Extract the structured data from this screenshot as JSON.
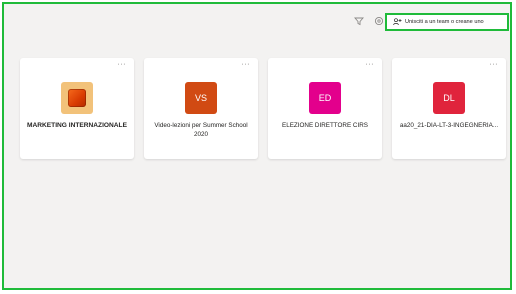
{
  "toolbar": {
    "filter_icon": "filter-icon",
    "settings_icon": "gear-icon",
    "join_button_icon": "people-add-icon",
    "join_button_label": "Unisciti a un team o creane uno"
  },
  "teams": [
    {
      "name": "MARKETING INTERNAZIONALE",
      "initials": "",
      "color": "#f2c27a",
      "more": "···"
    },
    {
      "name": "Video-lezioni per Summer School 2020",
      "initials": "VS",
      "color": "#d14a13",
      "more": "···"
    },
    {
      "name": "ELEZIONE DIRETTORE CIRS",
      "initials": "ED",
      "color": "#e3008c",
      "more": "···"
    },
    {
      "name": "aa20_21-DIA-LT-3-INGEGNERIA...",
      "initials": "DL",
      "color": "#e0243c",
      "more": "···"
    }
  ],
  "colors": {
    "frame_border": "#1fbb3a",
    "background": "#f3f2f1"
  }
}
